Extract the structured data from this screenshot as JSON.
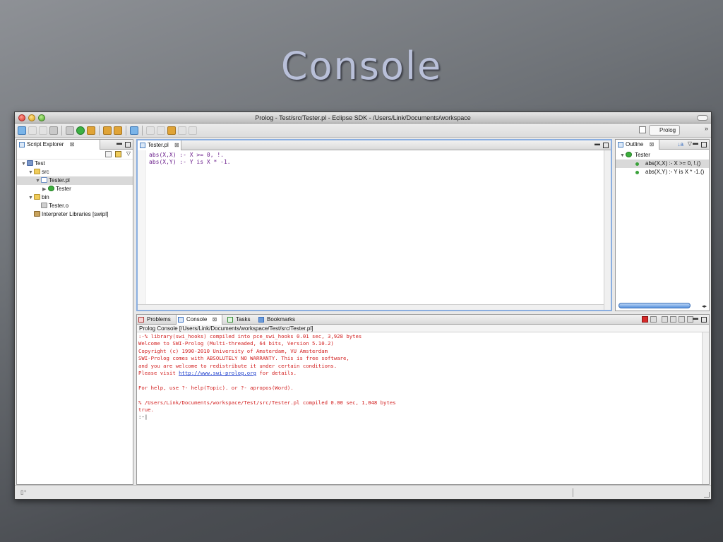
{
  "slide": {
    "title": "Console"
  },
  "window": {
    "title": "Prolog - Test/src/Tester.pl - Eclipse SDK - /Users/Link/Documents/workspace"
  },
  "toolbar": {
    "perspective_label": "Prolog",
    "overflow_label": "»"
  },
  "script_explorer": {
    "tab_label": "Script Explorer",
    "close": "⊠",
    "tree": [
      {
        "label": "Test",
        "icon": "project-icon",
        "indent": 0,
        "twisty": "▼"
      },
      {
        "label": "src",
        "icon": "folder-icon",
        "indent": 1,
        "twisty": "▼"
      },
      {
        "label": "Tester.pl",
        "icon": "prolog-file-icon",
        "indent": 2,
        "twisty": "▼",
        "selected": true
      },
      {
        "label": "Tester",
        "icon": "module-icon",
        "indent": 3,
        "twisty": "▶"
      },
      {
        "label": "bin",
        "icon": "folder-icon",
        "indent": 1,
        "twisty": "▼"
      },
      {
        "label": "Tester.o",
        "icon": "object-file-icon",
        "indent": 2,
        "twisty": ""
      },
      {
        "label": "Interpreter Libraries [swipl]",
        "icon": "library-icon",
        "indent": 1,
        "twisty": ""
      }
    ]
  },
  "editor": {
    "tab_label": "Tester.pl",
    "close": "⊠",
    "lines": [
      "abs(X,X) :- X >= 0, !.",
      "abs(X,Y) :- Y is X * -1."
    ]
  },
  "outline": {
    "tab_label": "Outline",
    "close": "⊠",
    "root": "Tester",
    "items": [
      "abs(X,X) :- X >= 0, !.()",
      "abs(X,Y) :- Y is X * -1.()"
    ]
  },
  "bottom_tabs": {
    "problems": "Problems",
    "console": "Console",
    "console_close": "⊠",
    "tasks": "Tasks",
    "bookmarks": "Bookmarks"
  },
  "console": {
    "path": "Prolog Console [/Users/Link/Documents/workspace/Test/src/Tester.pl]",
    "lines": [
      ":-% library(swi_hooks) compiled into pce_swi_hooks 0.01 sec, 3,928 bytes",
      "Welcome to SWI-Prolog (Multi-threaded, 64 bits, Version 5.10.2)",
      "Copyright (c) 1990-2010 University of Amsterdam, VU Amsterdam",
      "SWI-Prolog comes with ABSOLUTELY NO WARRANTY. This is free software,",
      "and you are welcome to redistribute it under certain conditions.",
      "",
      "",
      "For help, use ?- help(Topic). or ?- apropos(Word).",
      "",
      "% /Users/Link/Documents/workspace/Test/src/Tester.pl compiled 0.00 sec, 1,048 bytes",
      "true.",
      ":-|"
    ],
    "visit_prefix": "Please visit ",
    "visit_link": "http://www.swi-prolog.org",
    "visit_suffix": " for details."
  },
  "colors": {
    "console_text": "#d21f1f",
    "link": "#1a3ccc",
    "selection": "#d9d9d9"
  }
}
